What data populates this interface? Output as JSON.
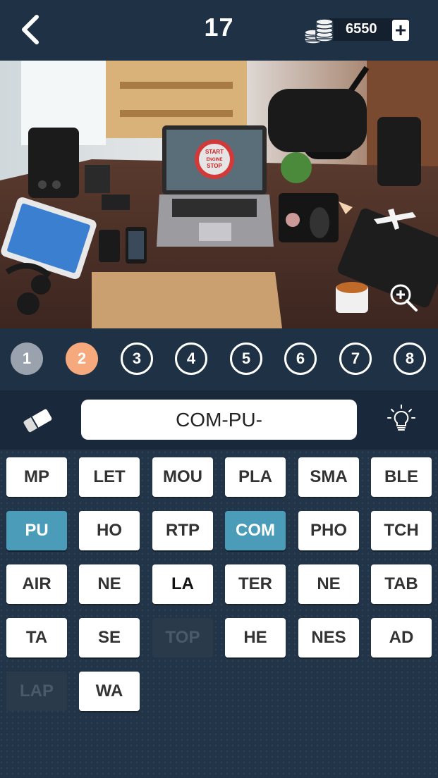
{
  "header": {
    "level": "17",
    "coins": "6550",
    "plus_label": "+"
  },
  "photo": {
    "laptop_screen_text": [
      "START",
      "ENGINE",
      "STOP"
    ]
  },
  "levels": [
    {
      "label": "1",
      "state": "done"
    },
    {
      "label": "2",
      "state": "active"
    },
    {
      "label": "3",
      "state": "open"
    },
    {
      "label": "4",
      "state": "open"
    },
    {
      "label": "5",
      "state": "open"
    },
    {
      "label": "6",
      "state": "open"
    },
    {
      "label": "7",
      "state": "open"
    },
    {
      "label": "8",
      "state": "open"
    }
  ],
  "answer": {
    "text": "COM-PU-"
  },
  "tiles": [
    {
      "label": "MP",
      "state": "normal"
    },
    {
      "label": "LET",
      "state": "normal"
    },
    {
      "label": "MOU",
      "state": "normal"
    },
    {
      "label": "PLA",
      "state": "normal"
    },
    {
      "label": "SMA",
      "state": "normal"
    },
    {
      "label": "BLE",
      "state": "normal"
    },
    {
      "label": "PU",
      "state": "selected"
    },
    {
      "label": "HO",
      "state": "normal"
    },
    {
      "label": "RTP",
      "state": "normal"
    },
    {
      "label": "COM",
      "state": "selected"
    },
    {
      "label": "PHO",
      "state": "normal"
    },
    {
      "label": "TCH",
      "state": "normal"
    },
    {
      "label": "AIR",
      "state": "normal"
    },
    {
      "label": "NE",
      "state": "normal"
    },
    {
      "label": "LA",
      "state": "dark"
    },
    {
      "label": "TER",
      "state": "normal"
    },
    {
      "label": "NE",
      "state": "normal"
    },
    {
      "label": "TAB",
      "state": "normal"
    },
    {
      "label": "TA",
      "state": "normal"
    },
    {
      "label": "SE",
      "state": "normal"
    },
    {
      "label": "TOP",
      "state": "used"
    },
    {
      "label": "HE",
      "state": "normal"
    },
    {
      "label": "NES",
      "state": "normal"
    },
    {
      "label": "AD",
      "state": "normal"
    },
    {
      "label": "LAP",
      "state": "used"
    },
    {
      "label": "WA",
      "state": "normal"
    }
  ],
  "colors": {
    "accent_selected": "#4b9cb8",
    "active_level": "#f5a97c",
    "background": "#223548"
  },
  "icons": {
    "back": "chevron-left-icon",
    "coins": "coin-stack-icon",
    "zoom": "zoom-in-icon",
    "eraser": "eraser-icon",
    "hint": "lightbulb-icon"
  }
}
